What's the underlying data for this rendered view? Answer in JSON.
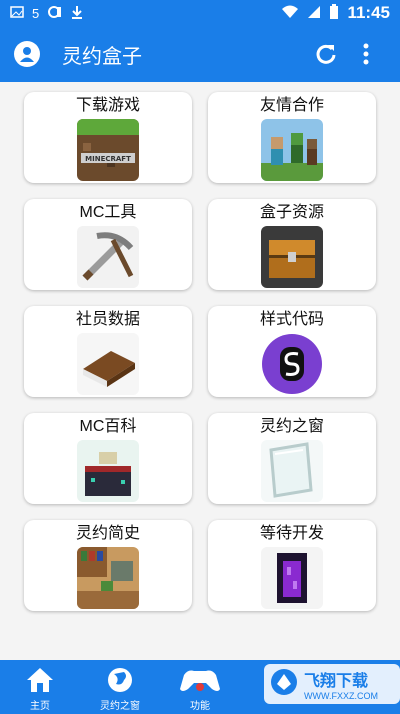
{
  "status_bar": {
    "time": "11:45",
    "left_text": "5"
  },
  "app_bar": {
    "title": "灵约盒子",
    "refresh_icon": "refresh-icon",
    "menu_icon": "more-vertical-icon"
  },
  "colors": {
    "primary": "#1a7ee8",
    "card_bg": "#ffffff",
    "page_bg": "#f4f4f4"
  },
  "grid": {
    "items": [
      {
        "label": "下载游戏",
        "icon": "minecraft-logo-icon"
      },
      {
        "label": "友情合作",
        "icon": "characters-icon"
      },
      {
        "label": "MC工具",
        "icon": "sword-pickaxe-icon"
      },
      {
        "label": "盒子资源",
        "icon": "chest-icon"
      },
      {
        "label": "社员数据",
        "icon": "book-icon"
      },
      {
        "label": "样式代码",
        "icon": "s-badge-icon"
      },
      {
        "label": "MC百科",
        "icon": "enchanting-table-icon"
      },
      {
        "label": "灵约之窗",
        "icon": "glass-pane-icon"
      },
      {
        "label": "灵约简史",
        "icon": "bookshelf-room-icon"
      },
      {
        "label": "等待开发",
        "icon": "obsidian-portal-icon"
      }
    ]
  },
  "bottom_nav": {
    "items": [
      {
        "label": "主页",
        "icon": "home-icon"
      },
      {
        "label": "灵约之窗",
        "icon": "globe-icon"
      },
      {
        "label": "功能",
        "icon": "gamepad-icon"
      },
      {
        "label": "",
        "icon": "placeholder-icon"
      },
      {
        "label": "",
        "icon": "placeholder-icon"
      }
    ]
  },
  "watermark": {
    "main": "飞翔下载",
    "sub": "WWW.FXXZ.COM"
  }
}
